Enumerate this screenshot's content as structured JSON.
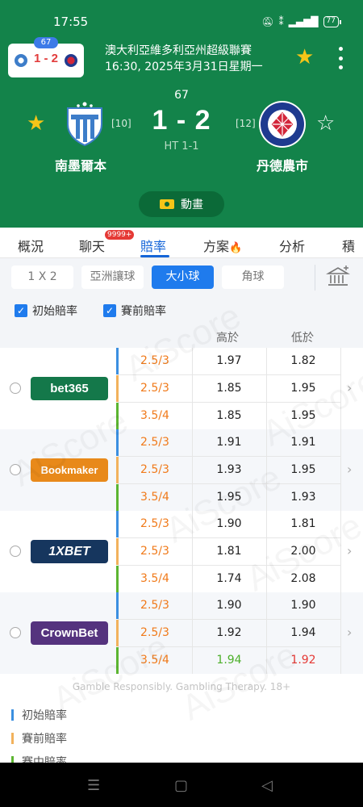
{
  "status": {
    "time": "17:55",
    "battery": "77"
  },
  "mini": {
    "minute": "67",
    "score": "1 - 2"
  },
  "league": {
    "name": "澳大利亞維多利亞州超級聯賽",
    "date": "16:30, 2025年3月31日星期一"
  },
  "match": {
    "minute": "67",
    "score": "1 - 2",
    "ht": "HT 1-1",
    "home": {
      "name": "南墨爾本",
      "rank": "[10]"
    },
    "away": {
      "name": "丹德農市",
      "rank": "[12]"
    }
  },
  "animation_label": "動畫",
  "tabs": [
    {
      "label": "概況"
    },
    {
      "label": "聊天",
      "badge": "9999+"
    },
    {
      "label": "賠率"
    },
    {
      "label": "方案"
    },
    {
      "label": "分析"
    },
    {
      "label": "積分"
    }
  ],
  "markets": [
    "1 X 2",
    "亞洲讓球",
    "大小球",
    "角球"
  ],
  "checks": [
    "初始賠率",
    "賽前賠率"
  ],
  "columns": {
    "high": "高於",
    "low": "低於"
  },
  "companies": [
    {
      "name": "bet365",
      "color": "#14784a",
      "rows": [
        [
          "2.5/3",
          "1.97",
          "1.82"
        ],
        [
          "2.5/3",
          "1.85",
          "1.95"
        ],
        [
          "3.5/4",
          "1.85",
          "1.95"
        ]
      ]
    },
    {
      "name": "Bookmaker",
      "color": "#e8891a",
      "rows": [
        [
          "2.5/3",
          "1.91",
          "1.91"
        ],
        [
          "2.5/3",
          "1.93",
          "1.95"
        ],
        [
          "3.5/4",
          "1.95",
          "1.93"
        ]
      ]
    },
    {
      "name": "1XBET",
      "color": "#16365e",
      "rows": [
        [
          "2.5/3",
          "1.90",
          "1.81"
        ],
        [
          "2.5/3",
          "1.81",
          "2.00"
        ],
        [
          "3.5/4",
          "1.74",
          "2.08"
        ]
      ]
    },
    {
      "name": "CrownBet",
      "color": "#55337e",
      "rows": [
        [
          "2.5/3",
          "1.90",
          "1.90"
        ],
        [
          "2.5/3",
          "1.92",
          "1.94"
        ],
        [
          "3.5/4",
          "1.94",
          "1.92"
        ]
      ]
    }
  ],
  "disclaimer": "Gamble Responsibly. Gambling Therapy. 18+",
  "legend": [
    {
      "label": "初始賠率",
      "color": "#3b8fe0"
    },
    {
      "label": "賽前賠率",
      "color": "#f2b25c"
    },
    {
      "label": "賽中賠率",
      "color": "#5cb531"
    }
  ],
  "watermark": "AiScore",
  "colors": {
    "header": "#13834a",
    "accent": "#1f7bed",
    "line": "#f07a1a",
    "up": "#4caf2a",
    "down": "#e53935"
  }
}
